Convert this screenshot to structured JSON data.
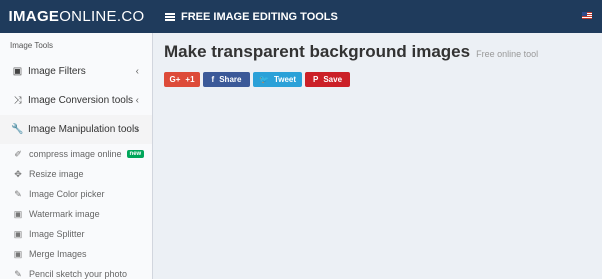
{
  "header": {
    "logo_bold": "IMAGE",
    "logo_thin": " ONLINE.CO",
    "nav_title": "FREE IMAGE EDITING TOOLS",
    "flag_icon": "us-flag-icon"
  },
  "sidebar": {
    "header": "Image Tools",
    "menu": [
      {
        "label": "Image Filters",
        "icon": "image-icon",
        "glyph": "▣"
      },
      {
        "label": "Image Conversion tools",
        "icon": "shuffle-icon",
        "glyph": "⤨"
      },
      {
        "label": "Image Manipulation tools",
        "icon": "wrench-icon",
        "glyph": "🔧"
      }
    ],
    "chevron": "‹",
    "subitems": [
      {
        "label": "compress image online",
        "badge": "new",
        "glyph": "✐"
      },
      {
        "label": "Resize image",
        "glyph": "✥"
      },
      {
        "label": "Image Color picker",
        "glyph": "✎"
      },
      {
        "label": "Watermark image",
        "glyph": "▣"
      },
      {
        "label": "Image Splitter",
        "glyph": "▣"
      },
      {
        "label": "Merge Images",
        "glyph": "▣"
      },
      {
        "label": "Pencil sketch your photo",
        "glyph": "✎"
      }
    ]
  },
  "main": {
    "title": "Make transparent background images",
    "subtitle": "Free online tool",
    "share": [
      {
        "label": "+1",
        "icon": "G+",
        "color": "#dd4b39"
      },
      {
        "label": "Share",
        "icon": "f",
        "color": "#3b5998"
      },
      {
        "label": "Tweet",
        "icon": "🐦",
        "color": "#2ba1d8"
      },
      {
        "label": "Save",
        "icon": "P",
        "color": "#cb2027"
      }
    ]
  }
}
